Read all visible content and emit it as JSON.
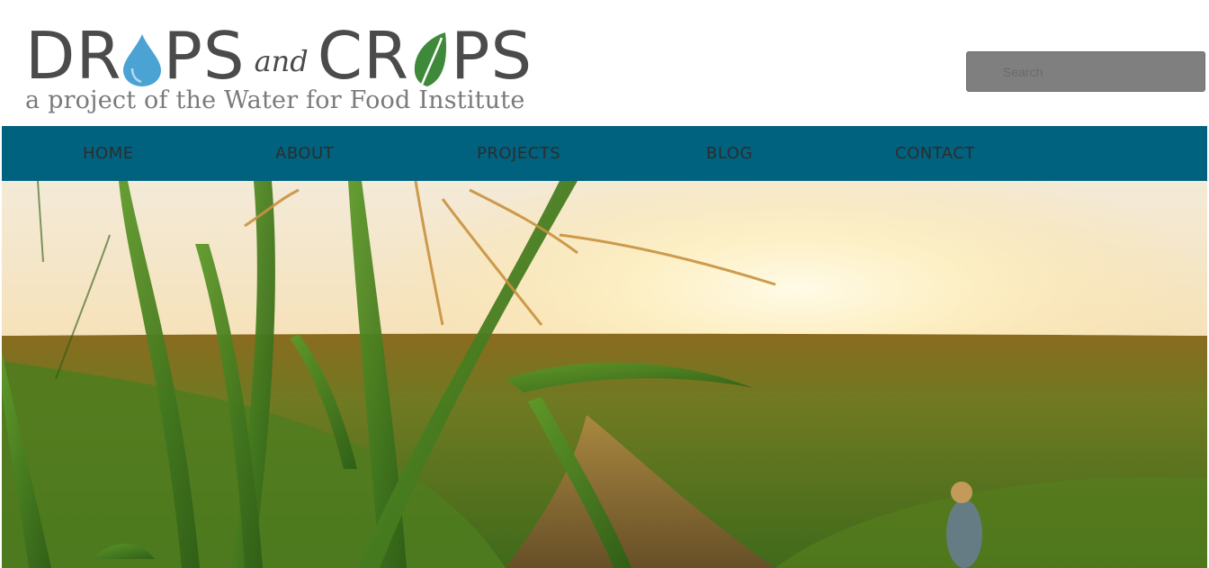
{
  "logo": {
    "word_left_a": "DR",
    "word_left_b": "PS",
    "word_and": "and",
    "word_right_a": "CR",
    "word_right_b": "PS",
    "tagline": "a project of the Water for Food Institute",
    "drop_color": "#4ba3d3",
    "leaf_color": "#3e8a3a"
  },
  "search": {
    "placeholder": "Search"
  },
  "nav": {
    "background": "#00627f",
    "items": [
      {
        "label": "HOME"
      },
      {
        "label": "ABOUT"
      },
      {
        "label": "PROJECTS"
      },
      {
        "label": "BLOG"
      },
      {
        "label": "CONTACT"
      }
    ]
  },
  "hero": {
    "icon": "cornfield-sunset-photo"
  }
}
